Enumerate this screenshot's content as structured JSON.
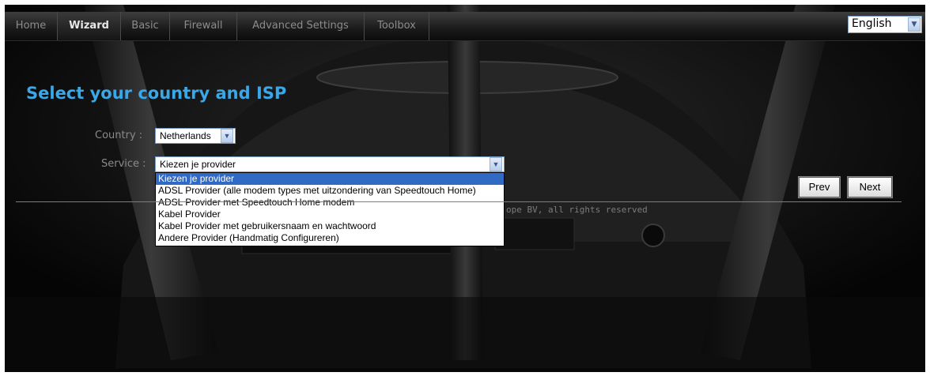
{
  "nav": {
    "tabs": [
      {
        "label": "Home"
      },
      {
        "label": "Wizard"
      },
      {
        "label": "Basic"
      },
      {
        "label": "Firewall"
      },
      {
        "label": "Advanced Settings"
      },
      {
        "label": "Toolbox"
      }
    ],
    "language": "English"
  },
  "wizard": {
    "title": "Select your country and ISP",
    "country_label": "Country :",
    "country_value": "Netherlands",
    "service_label": "Service :",
    "service_value": "Kiezen je provider",
    "service_options": [
      "Kiezen je provider",
      "ADSL Provider (alle modem types met uitzondering van Speedtouch Home)",
      "ADSL Provider met Speedtouch Home modem",
      "Kabel Provider",
      "Kabel Provider met gebruikersnaam en wachtwoord",
      "Andere Provider (Handmatig Configureren)"
    ],
    "prev_label": "Prev",
    "next_label": "Next"
  },
  "footer": {
    "copyright": "ope BV, all rights reserved"
  },
  "colors": {
    "accent": "#3aa7e8",
    "selected_option": "#316ac5",
    "divider": "#3f8fc0"
  }
}
